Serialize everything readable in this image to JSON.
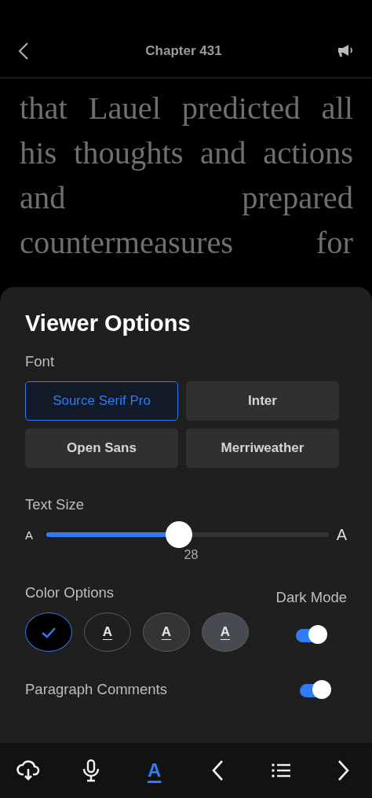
{
  "header": {
    "title": "Chapter 431"
  },
  "reading_text": "that Lauel predicted all his thoughts and actions and prepared countermeasures for",
  "viewer_options": {
    "title": "Viewer Options",
    "font": {
      "label": "Font",
      "options": [
        {
          "label": "Source Serif Pro",
          "selected": true
        },
        {
          "label": "Inter",
          "selected": false
        },
        {
          "label": "Open Sans",
          "selected": false
        },
        {
          "label": "Merriweather",
          "selected": false
        }
      ]
    },
    "text_size": {
      "label": "Text Size",
      "small_label": "A",
      "large_label": "A",
      "level": 0.47,
      "value": "28"
    },
    "color_options": {
      "label": "Color Options",
      "swatches": [
        {
          "color": "#000000",
          "selected": true
        },
        {
          "color": "#1f1f1f",
          "selected": false,
          "glyph": "A"
        },
        {
          "color": "#343434",
          "selected": false,
          "glyph": "A"
        },
        {
          "color": "#474a50",
          "selected": false,
          "glyph": "A"
        }
      ]
    },
    "dark_mode": {
      "label": "Dark Mode",
      "on": true
    },
    "paragraph_comments": {
      "label": "Paragraph Comments",
      "on": true
    }
  },
  "toolbar": [
    {
      "kind": "download",
      "selected": false
    },
    {
      "kind": "mic",
      "selected": false
    },
    {
      "kind": "text",
      "glyph": "A",
      "selected": true
    },
    {
      "kind": "prev",
      "selected": false
    },
    {
      "kind": "list",
      "selected": false
    },
    {
      "kind": "next",
      "selected": false
    }
  ]
}
